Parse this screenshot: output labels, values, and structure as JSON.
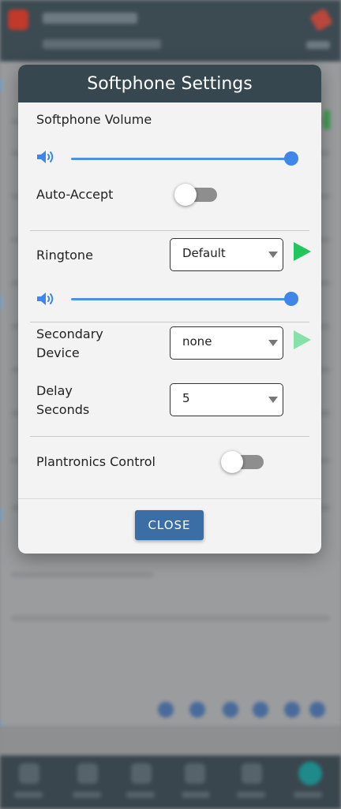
{
  "dialog": {
    "title": "Softphone Settings",
    "close_label": "CLOSE"
  },
  "softphone_volume": {
    "label": "Softphone Volume",
    "value_fraction": 1.0
  },
  "auto_accept": {
    "label": "Auto-Accept",
    "enabled": false
  },
  "ringtone": {
    "label": "Ringtone",
    "selected": "Default",
    "volume_fraction": 1.0,
    "play_enabled": true
  },
  "secondary_device": {
    "label_line1": "Secondary",
    "label_line2": "Device",
    "selected": "none",
    "play_enabled": false
  },
  "delay_seconds": {
    "label_line1": "Delay",
    "label_line2": "Seconds",
    "selected": "5"
  },
  "plantronics_control": {
    "label": "Plantronics Control",
    "enabled": false
  },
  "icons": {
    "volume": "speaker-volume-icon",
    "play": "play-icon",
    "dropdown": "chevron-down-icon"
  },
  "colors": {
    "header_bg": "#37474f",
    "accent_blue": "#3f85ea",
    "close_button": "#3a6ea5",
    "play_active": "#22c55e",
    "play_disabled": "#86e0a8",
    "toggle_off": "#8e8e8e"
  }
}
